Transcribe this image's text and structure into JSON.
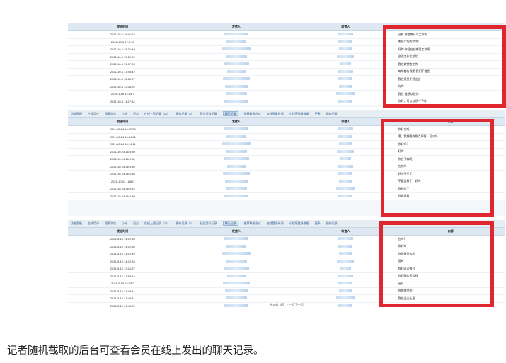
{
  "panels": [
    {
      "tabs": [],
      "headers": [
        "发送时间",
        "发信人",
        "收信人",
        "内容"
      ],
      "rows": [
        {
          "time": "2021-10-6 16:41:18",
          "msg": "没有 你是做什么工作的"
        },
        {
          "time": "2021-10-6 17:6:18",
          "msg": "朋友介绍的 你呢"
        },
        {
          "time": "2021-10-6 15:21:49",
          "msg": "好的 你现在在哪里工作呢"
        },
        {
          "time": "2021-10-6 15:20:52",
          "msg": "这边工作比较忙"
        },
        {
          "time": "2021-10-6 15:07:03",
          "msg": "我在做销售工作"
        },
        {
          "time": "2021-10-6 13:49:42",
          "msg": "每年都有假期 我们不着急"
        },
        {
          "time": "2021-10-6 12:59:27",
          "msg": "我在家里不想出去"
        },
        {
          "time": "2021-10-6 12:35:52",
          "msg": "有的"
        },
        {
          "time": "2021-10-6 12:29:7",
          "msg": "我在 我想认识你"
        },
        {
          "time": "2021-10-6 11:27:54",
          "msg": "你好，可以认识一下吗"
        }
      ]
    },
    {
      "tabs": [
        "功能面板",
        "在线用户",
        "搜索浏览",
        "小计",
        "日志",
        "在线上登记录（20）",
        "操作记录（0）",
        "征信资料记录",
        "聊天记录",
        "推荐联系方式",
        "查找登录时间",
        "小程序登录数据",
        "更多",
        "操作记录"
      ],
      "active_tab": 8,
      "headers": [
        "发送时间",
        "发信人",
        "收信人",
        "内容"
      ],
      "rows": [
        {
          "time": "2021-10-24 16:17:59",
          "msg": "你好在吗"
        },
        {
          "time": "2021-10-24 16:14:41",
          "msg": "嗯，我想跟你聊点事情，可以吗"
        },
        {
          "time": "2021-10-24 16:14:11",
          "msg": "你好吗？"
        },
        {
          "time": "2021-10-24 16:3:30",
          "msg": "好的"
        },
        {
          "time": "2021-10-24 16:9:30",
          "msg": "你在干嘛呢"
        },
        {
          "time": "2021-10-24 16:5:30",
          "msg": "在忙吗"
        },
        {
          "time": "2021-10-24 16:6:30",
          "msg": "好久不见了"
        },
        {
          "time": "2021-10-24 16:8:0",
          "msg": "不要这样了，好吗"
        },
        {
          "time": "2021-10-24 16:5:52",
          "msg": "我想你了"
        },
        {
          "time": "2021-10-24 16:4:30",
          "msg": "你说说看"
        }
      ]
    },
    {
      "tabs": [
        "功能面板",
        "在线用户",
        "搜索浏览",
        "小计",
        "日志",
        "在线上登记录（20）",
        "操作记录（0）",
        "征信资料记录",
        "聊天记录",
        "推荐联系方式",
        "查找登录时间",
        "小程序登录数据",
        "更多",
        "操作记录"
      ],
      "active_tab": 8,
      "headers": [
        "发送时间",
        "发信人",
        "收信人",
        "内容"
      ],
      "rows": [
        {
          "time": "2021-5-10 14:12:55",
          "msg": "在吗？"
        },
        {
          "time": "2021-5-10 14:12:56",
          "msg": "你好呀"
        },
        {
          "time": "2021-5-10 14:12:49",
          "msg": "你是做什么的"
        },
        {
          "time": "2021-5-10 14:12:26",
          "msg": "没有"
        },
        {
          "time": "2021-5-10 13:16:37",
          "msg": "我们这边很好"
        },
        {
          "time": "2021-5-10 13:53:44",
          "msg": "你们那边怎么样"
        },
        {
          "time": "2021-5-10 13:53:0",
          "msg": "还好"
        },
        {
          "time": "2021-5-10 13:49:31",
          "msg": "你是哪里的"
        },
        {
          "time": "2021-5-10 13:49:31",
          "msg": "我在这边上班"
        },
        {
          "time": "2021-5-10 13:49:22",
          "msg": "你是哪里的"
        }
      ],
      "pager": "共10条  首页  上一页  下一页"
    }
  ],
  "caption": "记者随机截取的后台可查看会员在线上发出的聊天记录。"
}
